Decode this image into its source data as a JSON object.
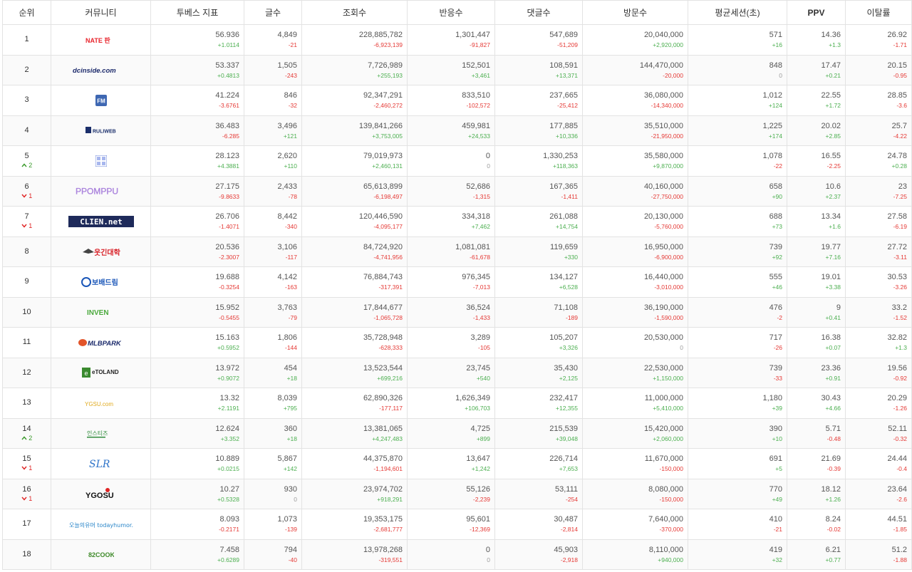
{
  "headers": [
    "순위",
    "커뮤니티",
    "투베스 지표",
    "글수",
    "조회수",
    "반응수",
    "댓글수",
    "방문수",
    "평균세션(초)",
    "PPV",
    "이탈률"
  ],
  "rows": [
    {
      "rank": "1",
      "chg": "",
      "dir": "",
      "logo": "nate",
      "vals": [
        "56.936",
        "4,849",
        "228,885,782",
        "1,301,447",
        "547,689",
        "20,040,000",
        "571",
        "14.36",
        "26.92"
      ],
      "deltas": [
        "+1.0114",
        "-21",
        "-6,923,139",
        "-91,827",
        "-51,209",
        "+2,920,000",
        "+16",
        "+1.3",
        "-1.71"
      ]
    },
    {
      "rank": "2",
      "chg": "",
      "dir": "",
      "logo": "dc",
      "vals": [
        "53.337",
        "1,505",
        "7,726,989",
        "152,501",
        "108,591",
        "144,470,000",
        "848",
        "17.47",
        "20.15"
      ],
      "deltas": [
        "+0.4813",
        "-243",
        "+255,193",
        "+3,461",
        "+13,371",
        "-20,000",
        "0",
        "+0.21",
        "-0.95"
      ]
    },
    {
      "rank": "3",
      "chg": "",
      "dir": "",
      "logo": "fm",
      "vals": [
        "41.224",
        "846",
        "92,347,291",
        "833,510",
        "237,665",
        "36,080,000",
        "1,012",
        "22.55",
        "28.85"
      ],
      "deltas": [
        "-3.6761",
        "-32",
        "-2,460,272",
        "-102,572",
        "-25,412",
        "-14,340,000",
        "+124",
        "+1.72",
        "-3.6"
      ]
    },
    {
      "rank": "4",
      "chg": "",
      "dir": "",
      "logo": "ruli",
      "vals": [
        "36.483",
        "3,496",
        "139,841,266",
        "459,981",
        "177,885",
        "35,510,000",
        "1,225",
        "20.02",
        "25.7"
      ],
      "deltas": [
        "-6.285",
        "+121",
        "+3,753,005",
        "+24,533",
        "+10,336",
        "-21,950,000",
        "+174",
        "+2.85",
        "-4.22"
      ]
    },
    {
      "rank": "5",
      "chg": "2",
      "dir": "up",
      "logo": "grid",
      "vals": [
        "28.123",
        "2,620",
        "79,019,973",
        "0",
        "1,330,253",
        "35,580,000",
        "1,078",
        "16.55",
        "24.78"
      ],
      "deltas": [
        "+4.3881",
        "+110",
        "+2,460,131",
        "0",
        "+118,363",
        "+9,870,000",
        "-22",
        "-2.25",
        "+0.28"
      ]
    },
    {
      "rank": "6",
      "chg": "1",
      "dir": "down",
      "logo": "ppomppu",
      "vals": [
        "27.175",
        "2,433",
        "65,613,899",
        "52,686",
        "167,365",
        "40,160,000",
        "658",
        "10.6",
        "23"
      ],
      "deltas": [
        "-9.8633",
        "-78",
        "-6,198,497",
        "-1,315",
        "-1,411",
        "-27,750,000",
        "+90",
        "+2.37",
        "-7.25"
      ]
    },
    {
      "rank": "7",
      "chg": "1",
      "dir": "down",
      "logo": "clien",
      "vals": [
        "26.706",
        "8,442",
        "120,446,590",
        "334,318",
        "261,088",
        "20,130,000",
        "688",
        "13.34",
        "27.58"
      ],
      "deltas": [
        "-1.4071",
        "-340",
        "-4,095,177",
        "+7,462",
        "+14,754",
        "-5,760,000",
        "+73",
        "+1.6",
        "-6.19"
      ]
    },
    {
      "rank": "8",
      "chg": "",
      "dir": "",
      "logo": "humor",
      "vals": [
        "20.536",
        "3,106",
        "84,724,920",
        "1,081,081",
        "119,659",
        "16,950,000",
        "739",
        "19.77",
        "27.72"
      ],
      "deltas": [
        "-2.3007",
        "-117",
        "-4,741,956",
        "-61,678",
        "+330",
        "-6,900,000",
        "+92",
        "+7.16",
        "-3.11"
      ]
    },
    {
      "rank": "9",
      "chg": "",
      "dir": "",
      "logo": "bobae",
      "vals": [
        "19.688",
        "4,142",
        "76,884,743",
        "976,345",
        "134,127",
        "16,440,000",
        "555",
        "19.01",
        "30.53"
      ],
      "deltas": [
        "-0.3254",
        "-163",
        "-317,391",
        "-7,013",
        "+6,528",
        "-3,010,000",
        "+46",
        "+3.38",
        "-3.26"
      ]
    },
    {
      "rank": "10",
      "chg": "",
      "dir": "",
      "logo": "inven",
      "vals": [
        "15.952",
        "3,763",
        "17,844,677",
        "36,524",
        "71,108",
        "36,190,000",
        "476",
        "9",
        "33.2"
      ],
      "deltas": [
        "-0.5455",
        "-79",
        "-1,065,728",
        "-1,433",
        "-189",
        "-1,590,000",
        "-2",
        "+0.41",
        "-1.52"
      ]
    },
    {
      "rank": "11",
      "chg": "",
      "dir": "",
      "logo": "mlb",
      "vals": [
        "15.163",
        "1,806",
        "35,728,948",
        "3,289",
        "105,207",
        "20,530,000",
        "717",
        "16.38",
        "32.82"
      ],
      "deltas": [
        "+0.5952",
        "-144",
        "-628,333",
        "-105",
        "+3,326",
        "0",
        "-26",
        "+0.07",
        "+1.3"
      ]
    },
    {
      "rank": "12",
      "chg": "",
      "dir": "",
      "logo": "etoland",
      "vals": [
        "13.972",
        "454",
        "13,523,544",
        "23,745",
        "35,430",
        "22,530,000",
        "739",
        "23.36",
        "19.56"
      ],
      "deltas": [
        "+0.9072",
        "+18",
        "+699,216",
        "+540",
        "+2,125",
        "+1,150,000",
        "-33",
        "+0.91",
        "-0.92"
      ]
    },
    {
      "rank": "13",
      "chg": "",
      "dir": "",
      "logo": "yesu",
      "vals": [
        "13.32",
        "8,039",
        "62,890,326",
        "1,626,349",
        "232,417",
        "11,000,000",
        "1,180",
        "30.43",
        "20.29"
      ],
      "deltas": [
        "+2.1191",
        "+795",
        "-177,117",
        "+106,703",
        "+12,355",
        "+5,410,000",
        "+39",
        "+4.66",
        "-1.26"
      ]
    },
    {
      "rank": "14",
      "chg": "2",
      "dir": "up",
      "logo": "instiz",
      "vals": [
        "12.624",
        "360",
        "13,381,065",
        "4,725",
        "215,539",
        "15,420,000",
        "390",
        "5.71",
        "52.11"
      ],
      "deltas": [
        "+3.352",
        "+18",
        "+4,247,483",
        "+899",
        "+39,048",
        "+2,060,000",
        "+10",
        "-0.48",
        "-0.32"
      ]
    },
    {
      "rank": "15",
      "chg": "1",
      "dir": "down",
      "logo": "slr",
      "vals": [
        "10.889",
        "5,867",
        "44,375,870",
        "13,647",
        "226,714",
        "11,670,000",
        "691",
        "21.69",
        "24.44"
      ],
      "deltas": [
        "+0.0215",
        "+142",
        "-1,194,601",
        "+1,242",
        "+7,653",
        "-150,000",
        "+5",
        "-0.39",
        "-0.4"
      ]
    },
    {
      "rank": "16",
      "chg": "1",
      "dir": "down",
      "logo": "ygosu",
      "vals": [
        "10.27",
        "930",
        "23,974,702",
        "55,126",
        "53,111",
        "8,080,000",
        "770",
        "18.12",
        "23.64"
      ],
      "deltas": [
        "+0.5328",
        "0",
        "+918,291",
        "-2,239",
        "-254",
        "-150,000",
        "+49",
        "+1.26",
        "-2.6"
      ]
    },
    {
      "rank": "17",
      "chg": "",
      "dir": "",
      "logo": "todayhumor",
      "vals": [
        "8.093",
        "1,073",
        "19,353,175",
        "95,601",
        "30,487",
        "7,640,000",
        "410",
        "8.24",
        "44.51"
      ],
      "deltas": [
        "-0.2171",
        "-139",
        "-2,681,777",
        "-12,369",
        "-2,814",
        "-370,000",
        "-21",
        "-0.02",
        "-1.85"
      ]
    },
    {
      "rank": "18",
      "chg": "",
      "dir": "",
      "logo": "82cook",
      "vals": [
        "7.458",
        "794",
        "13,978,268",
        "0",
        "45,903",
        "8,110,000",
        "419",
        "6.21",
        "51.2"
      ],
      "deltas": [
        "+0.6289",
        "-40",
        "-319,551",
        "0",
        "-2,918",
        "+940,000",
        "+32",
        "+0.77",
        "-1.88"
      ]
    }
  ],
  "logo_text": {
    "nate": "NATE 판",
    "dc": "dcinside.com",
    "fm": "FM",
    "ruli": "RULIWEB",
    "ppomppu": "PPOMPPU",
    "clien": "CLIEN.net",
    "humor": "웃긴대학",
    "bobae": "보배드림",
    "inven": "INVEN",
    "mlb": "MLBPARK",
    "etoland": "eTOLAND",
    "yesu": "YGSU.com",
    "instiz": "인스티즈",
    "slr": "SLR",
    "ygosu": "YGOSU",
    "todayhumor": "오늘의유머 todayhumor.co.kr",
    "82cook": "82COOK"
  }
}
